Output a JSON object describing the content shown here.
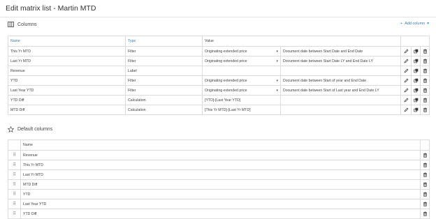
{
  "page": {
    "title": "Edit matrix list - Martin MTD"
  },
  "columns_section": {
    "title": "Columns",
    "add_label": "Add column",
    "headers": [
      "Name",
      "Type",
      "Value"
    ],
    "rows": [
      {
        "name": "This Yr MTD",
        "type": "Filter",
        "value": "Originating extended price",
        "filter": "Document date between Start Date and End Date"
      },
      {
        "name": "Last Yr MTD",
        "type": "Filter",
        "value": "Originating extended price",
        "filter": "Document date between Start Date LY and End Date LY"
      },
      {
        "name": "Revenue",
        "type": "Label",
        "value": "",
        "filter": ""
      },
      {
        "name": "YTD",
        "type": "Filter",
        "value": "Originating extended price",
        "filter": "Document date between Start of year and End Date"
      },
      {
        "name": "Last Year YTD",
        "type": "Filter",
        "value": "Originating extended price",
        "filter": "Document date between Start of Last year and End Date LY"
      },
      {
        "name": "YTD Diff",
        "type": "Calculation",
        "value": "[YTD]-[Last Year YTD]",
        "filter": ""
      },
      {
        "name": "MTD Diff",
        "type": "Calculation",
        "value": "[This Yr MTD]-[Last Yr MTD]",
        "filter": ""
      }
    ]
  },
  "default_section": {
    "title": "Default columns",
    "header": "Name",
    "rows": [
      "Revenue",
      "This Yr MTD",
      "Last Yr MTD",
      "MTD Diff",
      "YTD",
      "Last Year YTD",
      "YTD Diff"
    ]
  }
}
